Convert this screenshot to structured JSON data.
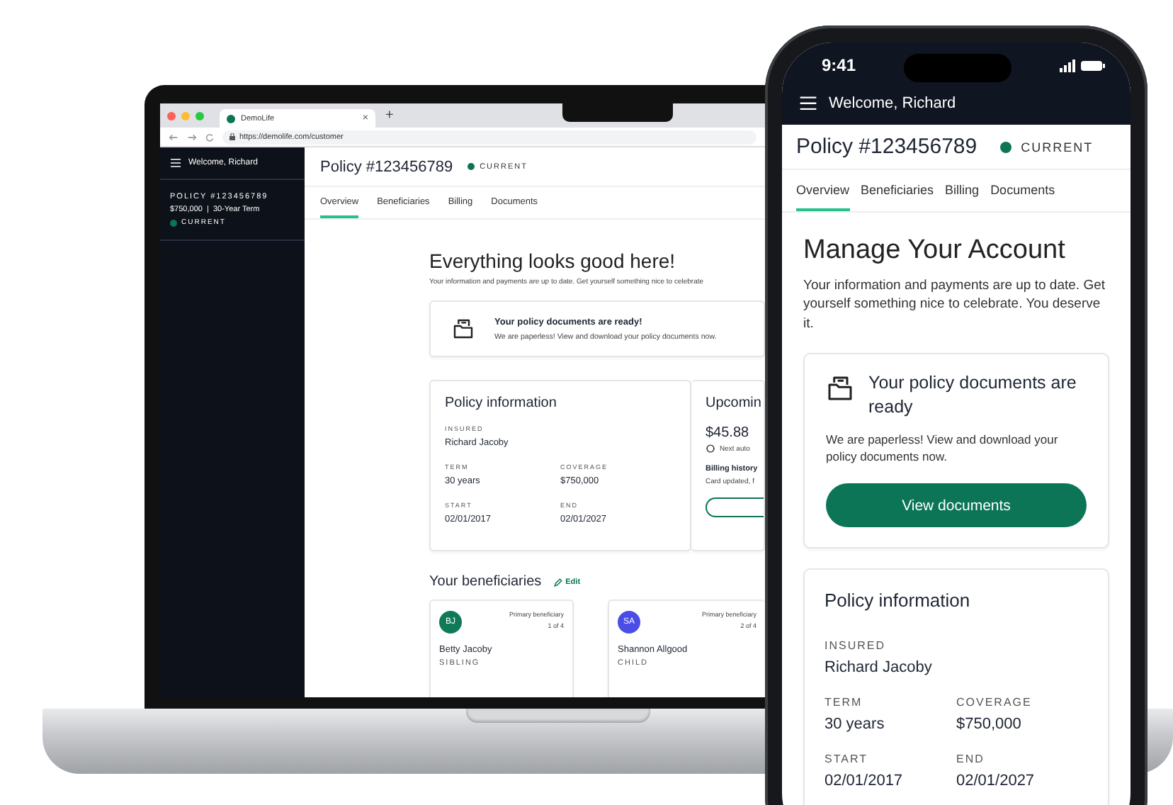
{
  "browser": {
    "tab_title": "DemoLife",
    "tab_close": "×",
    "new_tab": "+",
    "url": "https://demolife.com/customer"
  },
  "desktop": {
    "sidebar": {
      "greeting": "Welcome, Richard",
      "policy_number": "POLICY #123456789",
      "summary": "$750,000  |  30-Year Term",
      "status": "CURRENT"
    },
    "header": {
      "title": "Policy #123456789",
      "status": "CURRENT"
    },
    "tabs": [
      {
        "label": "Overview",
        "selected": true
      },
      {
        "label": "Beneficiaries",
        "selected": false
      },
      {
        "label": "Billing",
        "selected": false
      },
      {
        "label": "Documents",
        "selected": false
      }
    ],
    "hero": {
      "title": "Everything looks good here!",
      "text": "Your information and payments are up to date. Get yourself something nice to celebrate"
    },
    "documents_notice": {
      "title": "Your policy documents are ready!",
      "text": "We are paperless! View and download your policy documents now."
    },
    "policy_info": {
      "title": "Policy information",
      "insured": {
        "label": "INSURED",
        "value": "Richard Jacoby"
      },
      "details": [
        {
          "label": "TERM",
          "value": "30 years"
        },
        {
          "label": "COVERAGE",
          "value": "$750,000"
        },
        {
          "label": "START",
          "value": "02/01/2017"
        },
        {
          "label": "END",
          "value": "02/01/2027"
        }
      ]
    },
    "upcoming": {
      "title": "Upcomin",
      "amount": "$45.88",
      "autopay": "Next auto",
      "billing_title": "Billing history",
      "billing_text": "Card updated, f"
    },
    "beneficiaries": {
      "title": "Your beneficiaries",
      "edit": "Edit",
      "items": [
        {
          "initials": "BJ",
          "color": "#0e7a58",
          "role": "Primary beneficiary",
          "position": "1 of 4",
          "name": "Betty Jacoby",
          "relation": "SIBLING"
        },
        {
          "initials": "SA",
          "color": "#4b4ee6",
          "role": "Primary beneficiary",
          "position": "2 of 4",
          "name": "Shannon Allgood",
          "relation": "CHILD"
        }
      ]
    }
  },
  "phone": {
    "time": "9:41",
    "greeting": "Welcome, Richard",
    "title": "Policy #123456789",
    "status": "CURRENT",
    "tabs": [
      {
        "label": "Overview",
        "selected": true
      },
      {
        "label": "Beneficiaries",
        "selected": false
      },
      {
        "label": "Billing",
        "selected": false
      },
      {
        "label": "Documents",
        "selected": false
      }
    ],
    "heading": "Manage Your Account",
    "text": "Your information and payments are up to date. Get yourself something nice to celebrate. You deserve it.",
    "documents_notice": {
      "title": "Your policy documents are ready",
      "text": "We are paperless! View and download your policy documents now.",
      "button": "View documents"
    },
    "policy_info": {
      "title": "Policy information",
      "insured": {
        "label": "INSURED",
        "value": "Richard Jacoby"
      },
      "details": [
        {
          "label": "TERM",
          "value": "30 years"
        },
        {
          "label": "COVERAGE",
          "value": "$750,000"
        },
        {
          "label": "START",
          "value": "02/01/2017"
        },
        {
          "label": "END",
          "value": "02/01/2027"
        }
      ]
    }
  }
}
